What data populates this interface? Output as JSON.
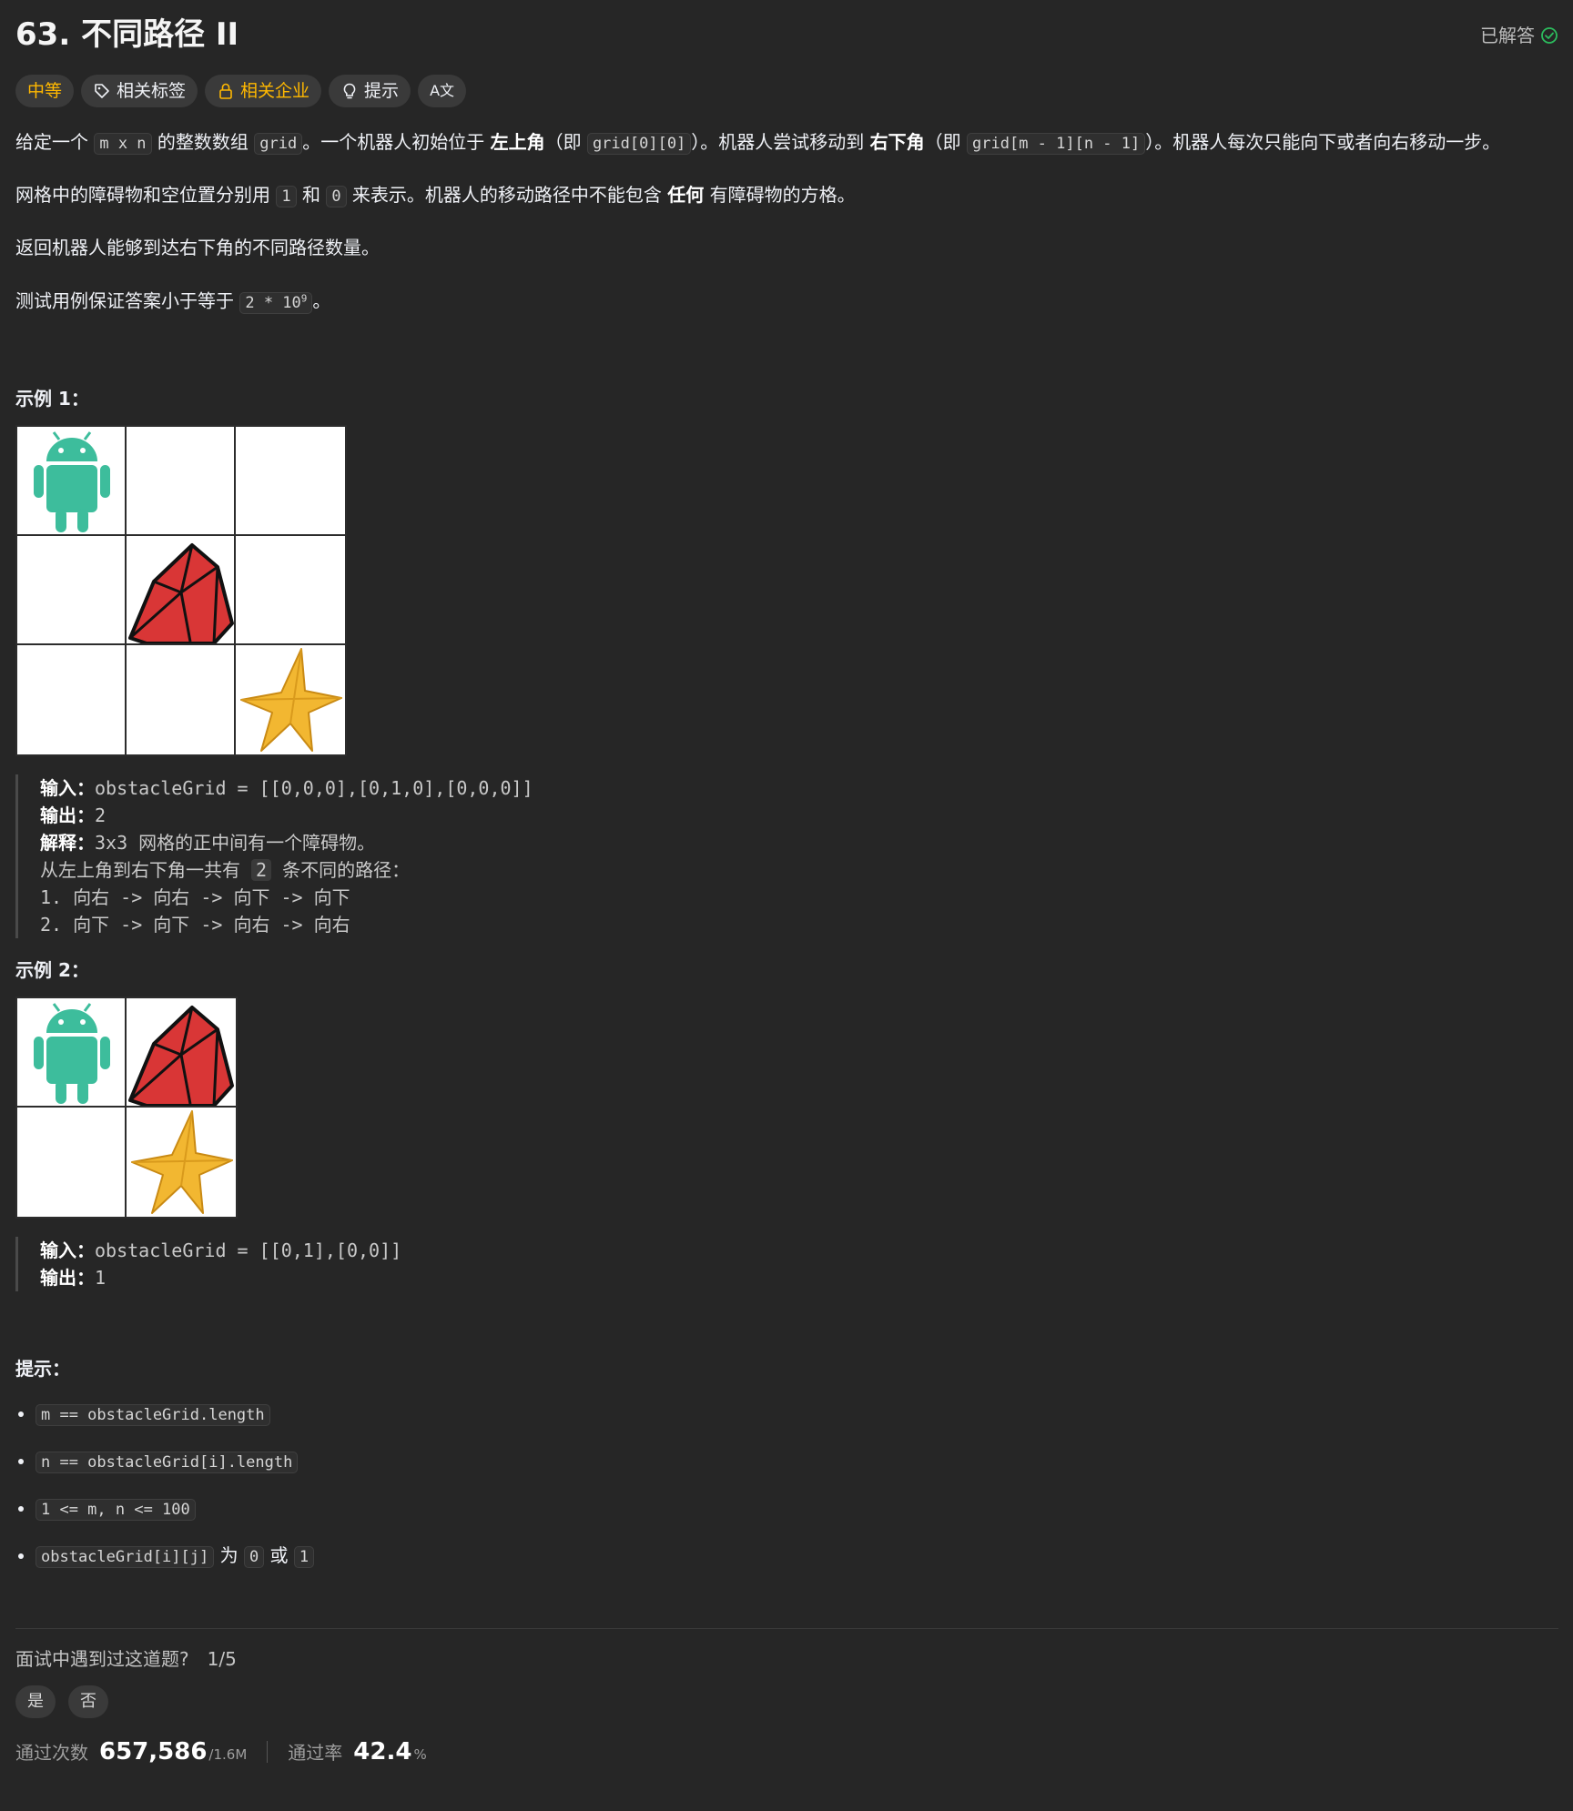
{
  "header": {
    "title": "63. 不同路径 II",
    "status": "已解答"
  },
  "tags": {
    "difficulty": "中等",
    "topics": "相关标签",
    "companies": "相关企业",
    "hint": "提示",
    "translate": "A文"
  },
  "description": {
    "p1": {
      "t1": "给定一个 ",
      "c1": "m x n",
      "t2": " 的整数数组 ",
      "c2": "grid",
      "t3": "。一个机器人初始位于 ",
      "b1": "左上角",
      "t4": "（即 ",
      "c3": "grid[0][0]",
      "t5": "）。机器人尝试移动到 ",
      "b2": "右下角",
      "t6": "（即 ",
      "c4": "grid[m - 1][n - 1]",
      "t7": "）。机器人每次只能向下或者向右移动一步。"
    },
    "p2": {
      "t1": "网格中的障碍物和空位置分别用 ",
      "c1": "1",
      "t2": " 和 ",
      "c2": "0",
      "t3": " 来表示。机器人的移动路径中不能包含 ",
      "b1": "任何",
      "t4": " 有障碍物的方格。"
    },
    "p3": "返回机器人能够到达右下角的不同路径数量。",
    "p4": {
      "t1": "测试用例保证答案小于等于 ",
      "c1": "2 * 10",
      "sup": "9",
      "t2": "。"
    }
  },
  "example1": {
    "title": "示例 1：",
    "input_label": "输入：",
    "input": "obstacleGrid = [[0,0,0],[0,1,0],[0,0,0]]",
    "output_label": "输出：",
    "output": "2",
    "explain_label": "解释：",
    "explain": "3x3 网格的正中间有一个障碍物。",
    "line1a": "从左上角到右下角一共有 ",
    "line1b": "2",
    "line1c": " 条不同的路径：",
    "line2": "1. 向右 -> 向右 -> 向下 -> 向下",
    "line3": "2. 向下 -> 向下 -> 向右 -> 向右"
  },
  "example2": {
    "title": "示例 2：",
    "input_label": "输入：",
    "input": "obstacleGrid = [[0,1],[0,0]]",
    "output_label": "输出：",
    "output": "1"
  },
  "hints": {
    "title": "提示：",
    "c1": "m == obstacleGrid.length",
    "c2": "n == obstacleGrid[i].length",
    "c3": "1 <= m, n <= 100",
    "c4a": "obstacleGrid[i][j]",
    "c4b": " 为 ",
    "c4c": "0",
    "c4d": " 或 ",
    "c4e": "1"
  },
  "interview": {
    "question": "面试中遇到过这道题?",
    "fraction": "1/5",
    "yes": "是",
    "no": "否"
  },
  "stats": {
    "submissions_label": "通过次数",
    "submissions": "657,586",
    "total": "/1.6M",
    "rate_label": "通过率",
    "rate": "42.4",
    "rate_unit": "%"
  },
  "colors": {
    "background": "#262626",
    "accent_yellow": "#ffb800",
    "solved_green": "#2cbb5d",
    "robot": "#3dbd9c",
    "obstacle": "#d93636",
    "star": "#f2b731"
  }
}
